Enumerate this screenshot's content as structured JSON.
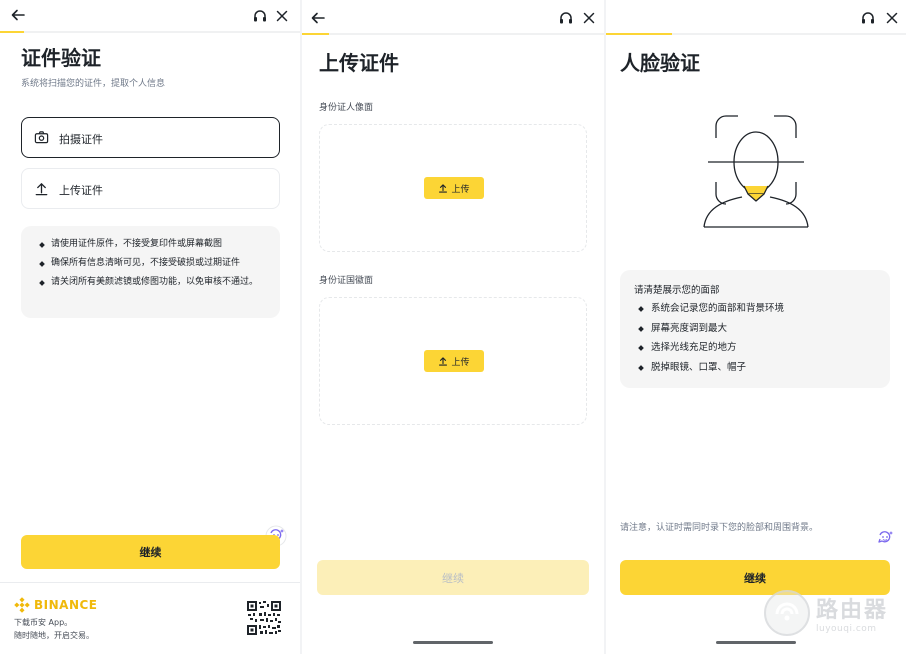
{
  "colors": {
    "accent": "#fcd535",
    "text": "#1e2329",
    "muted": "#707a8a",
    "brand": "#f0b90b"
  },
  "screen1": {
    "title": "证件验证",
    "subtitle": "系统将扫描您的证件，提取个人信息",
    "progress": 0.08,
    "options": [
      {
        "label": "拍摄证件",
        "icon": "camera-icon",
        "selected": true
      },
      {
        "label": "上传证件",
        "icon": "upload-icon",
        "selected": false
      }
    ],
    "tips": [
      "请使用证件原件，不接受复印件或屏幕截图",
      "确保所有信息清晰可见，不接受破损或过期证件",
      "请关闭所有美颜滤镜或修图功能，以免审核不通过。"
    ],
    "continue_label": "继续",
    "footer": {
      "brand": "BINANCE",
      "line1": "下载币安 App。",
      "line2": "随时随地，开启交易。"
    }
  },
  "screen2": {
    "title": "上传证件",
    "progress": 0.09,
    "front_label": "身份证人像面",
    "back_label": "身份证国徽面",
    "upload_label": "上传",
    "continue_label": "继续"
  },
  "screen3": {
    "title": "人脸验证",
    "progress": 0.22,
    "tips_head": "请清楚展示您的面部",
    "tips": [
      "系统会记录您的面部和背景环境",
      "屏幕亮度调到最大",
      "选择光线充足的地方",
      "脱掉眼镜、口罩、帽子"
    ],
    "note": "请注意，认证时需同时录下您的脸部和周围背景。",
    "continue_label": "继续"
  },
  "watermark": {
    "main": "路由器",
    "sub": "luyouqi.com"
  }
}
